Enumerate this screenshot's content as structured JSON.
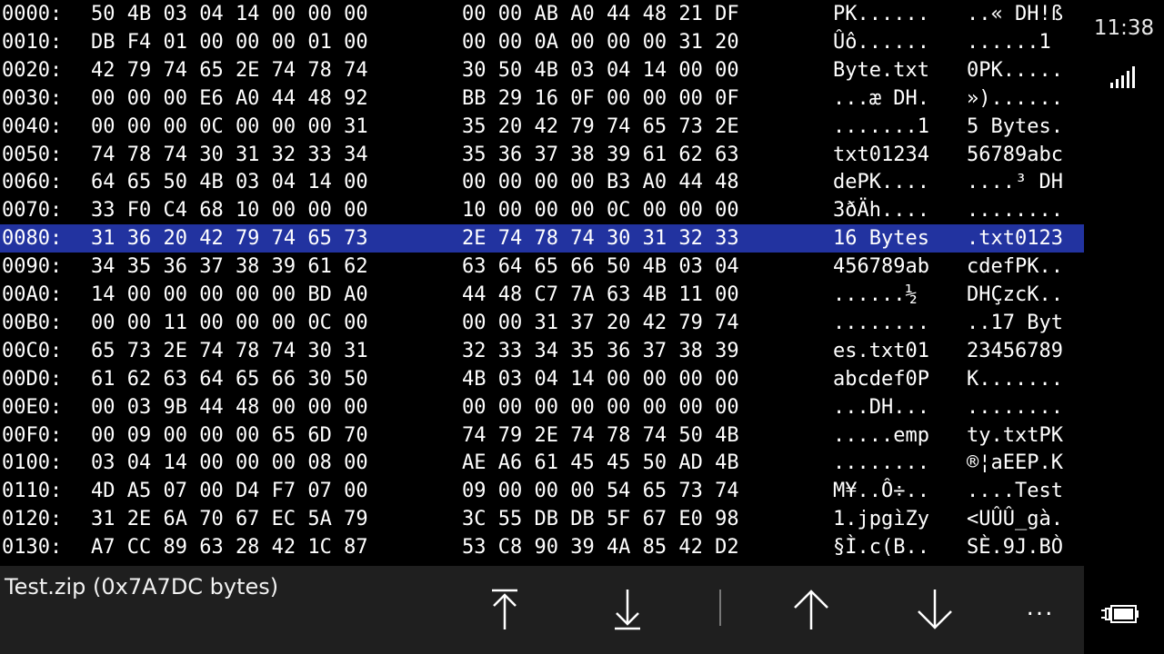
{
  "status_bar": {
    "time": "11:38",
    "signal_icon": "signal-strength-icon",
    "battery_icon": "battery-charging-icon"
  },
  "hex_view": {
    "selected_row": 8,
    "rows": [
      {
        "addr": "0000:",
        "hex1": "50 4B 03 04 14 00 00 00",
        "hex2": "00 00 AB A0 44 48 21 DF",
        "asc1": "PK......",
        "asc2": "..« DH!ß"
      },
      {
        "addr": "0010:",
        "hex1": "DB F4 01 00 00 00 01 00",
        "hex2": "00 00 0A 00 00 00 31 20",
        "asc1": "Ûô......",
        "asc2": "......1 "
      },
      {
        "addr": "0020:",
        "hex1": "42 79 74 65 2E 74 78 74",
        "hex2": "30 50 4B 03 04 14 00 00",
        "asc1": "Byte.txt",
        "asc2": "0PK....."
      },
      {
        "addr": "0030:",
        "hex1": "00 00 00 E6 A0 44 48 92",
        "hex2": "BB 29 16 0F 00 00 00 0F",
        "asc1": "...æ DH.",
        "asc2": "»)......"
      },
      {
        "addr": "0040:",
        "hex1": "00 00 00 0C 00 00 00 31",
        "hex2": "35 20 42 79 74 65 73 2E",
        "asc1": ".......1",
        "asc2": "5 Bytes."
      },
      {
        "addr": "0050:",
        "hex1": "74 78 74 30 31 32 33 34",
        "hex2": "35 36 37 38 39 61 62 63",
        "asc1": "txt01234",
        "asc2": "56789abc"
      },
      {
        "addr": "0060:",
        "hex1": "64 65 50 4B 03 04 14 00",
        "hex2": "00 00 00 00 B3 A0 44 48",
        "asc1": "dePK....",
        "asc2": "....³ DH"
      },
      {
        "addr": "0070:",
        "hex1": "33 F0 C4 68 10 00 00 00",
        "hex2": "10 00 00 00 0C 00 00 00",
        "asc1": "3ðÄh....",
        "asc2": "........"
      },
      {
        "addr": "0080:",
        "hex1": "31 36 20 42 79 74 65 73",
        "hex2": "2E 74 78 74 30 31 32 33",
        "asc1": "16 Bytes",
        "asc2": ".txt0123"
      },
      {
        "addr": "0090:",
        "hex1": "34 35 36 37 38 39 61 62",
        "hex2": "63 64 65 66 50 4B 03 04",
        "asc1": "456789ab",
        "asc2": "cdefPK.."
      },
      {
        "addr": "00A0:",
        "hex1": "14 00 00 00 00 00 BD A0",
        "hex2": "44 48 C7 7A 63 4B 11 00",
        "asc1": "......½ ",
        "asc2": "DHÇzcK.."
      },
      {
        "addr": "00B0:",
        "hex1": "00 00 11 00 00 00 0C 00",
        "hex2": "00 00 31 37 20 42 79 74",
        "asc1": "........",
        "asc2": "..17 Byt"
      },
      {
        "addr": "00C0:",
        "hex1": "65 73 2E 74 78 74 30 31",
        "hex2": "32 33 34 35 36 37 38 39",
        "asc1": "es.txt01",
        "asc2": "23456789"
      },
      {
        "addr": "00D0:",
        "hex1": "61 62 63 64 65 66 30 50",
        "hex2": "4B 03 04 14 00 00 00 00",
        "asc1": "abcdef0P",
        "asc2": "K......."
      },
      {
        "addr": "00E0:",
        "hex1": "00 03 9B 44 48 00 00 00",
        "hex2": "00 00 00 00 00 00 00 00",
        "asc1": "...DH...",
        "asc2": "........"
      },
      {
        "addr": "00F0:",
        "hex1": "00 09 00 00 00 65 6D 70",
        "hex2": "74 79 2E 74 78 74 50 4B",
        "asc1": ".....emp",
        "asc2": "ty.txtPK"
      },
      {
        "addr": "0100:",
        "hex1": "03 04 14 00 00 00 08 00",
        "hex2": "AE A6 61 45 45 50 AD 4B",
        "asc1": "........",
        "asc2": "®¦aEEP.K"
      },
      {
        "addr": "0110:",
        "hex1": "4D A5 07 00 D4 F7 07 00",
        "hex2": "09 00 00 00 54 65 73 74",
        "asc1": "M¥..Ô÷..",
        "asc2": "....Test"
      },
      {
        "addr": "0120:",
        "hex1": "31 2E 6A 70 67 EC 5A 79",
        "hex2": "3C 55 DB DB 5F 67 E0 98",
        "asc1": "1.jpgìZy",
        "asc2": "<UÛÛ_gà."
      },
      {
        "addr": "0130:",
        "hex1": "A7 CC 89 63 28 42 1C 87",
        "hex2": "53 C8 90 39 4A 85 42 D2",
        "asc1": "§Ì.c(B..",
        "asc2": "SÈ.9J.BÒ"
      }
    ]
  },
  "app_bar": {
    "file_title": "Test.zip (0x7A7DC bytes)",
    "buttons": [
      {
        "name": "scroll-to-top-icon"
      },
      {
        "name": "scroll-to-bottom-icon"
      },
      {
        "name": "page-up-icon"
      },
      {
        "name": "page-down-icon"
      },
      {
        "name": "more-icon",
        "label": "..."
      }
    ]
  },
  "colors": {
    "background": "#000000",
    "selection": "#2233a0",
    "appbar": "#1f1f1f",
    "text": "#ffffff"
  }
}
